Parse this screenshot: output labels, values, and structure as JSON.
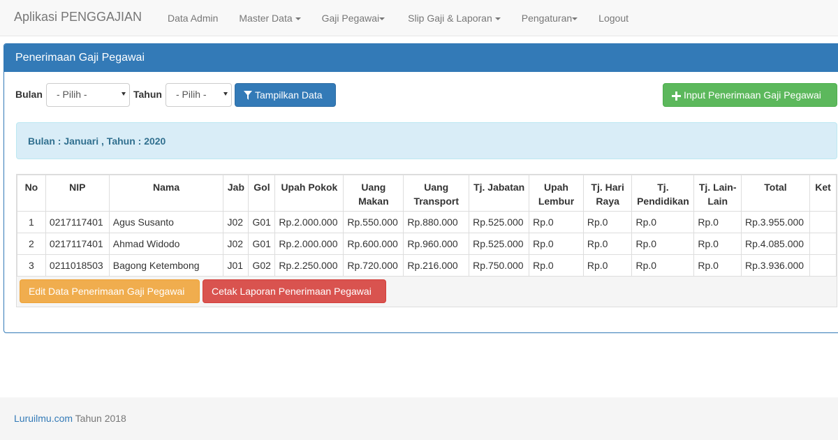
{
  "navbar": {
    "brand": "Aplikasi PENGGAJIAN",
    "items": [
      {
        "label": "Data Admin",
        "dropdown": false
      },
      {
        "label": "Master Data",
        "dropdown": true
      },
      {
        "label": "Gaji Pegawai",
        "dropdown": true
      },
      {
        "label": "Slip Gaji & Laporan",
        "dropdown": true
      },
      {
        "label": "Pengaturan",
        "dropdown": true
      },
      {
        "label": "Logout",
        "dropdown": false
      }
    ]
  },
  "panel": {
    "title": "Penerimaan Gaji Pegawai",
    "filter": {
      "bulan_label": "Bulan",
      "bulan_value": "- Pilih -",
      "tahun_label": "Tahun",
      "tahun_value": "- Pilih -",
      "show_button": "Tampilkan Data",
      "show_icon": "filter-icon"
    },
    "add_button": "Input Penerimaan Gaji Pegawai",
    "add_icon": "plus-icon",
    "info": "Bulan : Januari , Tahun : 2020",
    "table": {
      "headers": [
        "No",
        "NIP",
        "Nama",
        "Jab",
        "Gol",
        "Upah Pokok",
        "Uang Makan",
        "Uang Transport",
        "Tj. Jabatan",
        "Upah Lembur",
        "Tj. Hari Raya",
        "Tj. Pendidikan",
        "Tj. Lain-Lain",
        "Total",
        "Ket"
      ],
      "rows": [
        [
          "1",
          "0217117401",
          "Agus Susanto",
          "J02",
          "G01",
          "Rp.2.000.000",
          "Rp.550.000",
          "Rp.880.000",
          "Rp.525.000",
          "Rp.0",
          "Rp.0",
          "Rp.0",
          "Rp.0",
          "Rp.3.955.000",
          ""
        ],
        [
          "2",
          "0217117401",
          "Ahmad Widodo",
          "J02",
          "G01",
          "Rp.2.000.000",
          "Rp.600.000",
          "Rp.960.000",
          "Rp.525.000",
          "Rp.0",
          "Rp.0",
          "Rp.0",
          "Rp.0",
          "Rp.4.085.000",
          ""
        ],
        [
          "3",
          "0211018503",
          "Bagong Ketembong",
          "J01",
          "G02",
          "Rp.2.250.000",
          "Rp.720.000",
          "Rp.216.000",
          "Rp.750.000",
          "Rp.0",
          "Rp.0",
          "Rp.0",
          "Rp.0",
          "Rp.3.936.000",
          ""
        ]
      ]
    },
    "edit_button": "Edit Data Penerimaan Gaji Pegawai",
    "print_button": "Cetak Laporan Penerimaan Pegawai"
  },
  "footer": {
    "link": "Luruilmu.com",
    "text": " Tahun 2018"
  },
  "colors": {
    "primary": "#337ab7",
    "success": "#5cb85c",
    "warning": "#f0ad4e",
    "danger": "#d9534f",
    "info_bg": "#d9edf7"
  }
}
